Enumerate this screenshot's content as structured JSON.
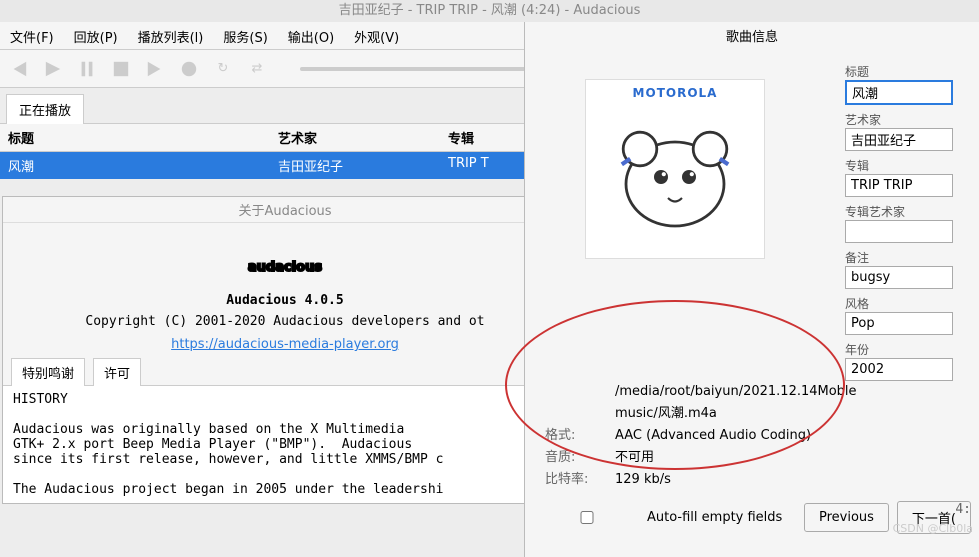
{
  "titlebar": "吉田亚纪子 - TRIP TRIP - 风潮 (4:24) - Audacious",
  "menu": {
    "file": "文件(F)",
    "playback": "回放(P)",
    "playlist": "播放列表(l)",
    "services": "服务(S)",
    "output": "输出(O)",
    "view": "外观(V)"
  },
  "nowplaying_tab": "正在播放",
  "headers": {
    "title": "标题",
    "artist": "艺术家",
    "album": "专辑"
  },
  "row": {
    "title": "风潮",
    "artist": "吉田亚纪子",
    "album": "TRIP T"
  },
  "about": {
    "title": "关于Audacious",
    "logo": "audacious",
    "version": "Audacious 4.0.5",
    "copyright": "Copyright (C) 2001-2020 Audacious developers and ot",
    "link": "https://audacious-media-player.org",
    "tab_thanks": "特别鸣谢",
    "tab_license": "许可",
    "body": "HISTORY\n\nAudacious was originally based on the X Multimedia\nGTK+ 2.x port Beep Media Player (\"BMP\").  Audacious\nsince its first release, however, and little XMMS/BMP c\n\nThe Audacious project began in 2005 under the leadershi"
  },
  "info": {
    "title": "歌曲信息",
    "brand": "MOTOROLA",
    "labels": {
      "title": "标题",
      "artist": "艺术家",
      "album": "专辑",
      "album_artist": "专辑艺术家",
      "comment": "备注",
      "genre": "风格",
      "year": "年份"
    },
    "values": {
      "title": "风潮",
      "artist": "吉田亚纪子",
      "album": "TRIP TRIP",
      "album_artist": "",
      "comment": "bugsy",
      "genre": "Pop",
      "year": "2002"
    },
    "path": "/media/root/baiyun/2021.12.14Moble music/风潮.m4a",
    "fmt_l": "格式:",
    "fmt_v": "AAC (Advanced Audio Coding)",
    "q_l": "音质:",
    "q_v": "不可用",
    "br_l": "比特率:",
    "br_v": "129 kb/s",
    "autofill": "Auto-fill empty fields",
    "prev": "Previous",
    "next": "下一首("
  },
  "time": "4:",
  "watermark": "CSDN @Clb0la"
}
